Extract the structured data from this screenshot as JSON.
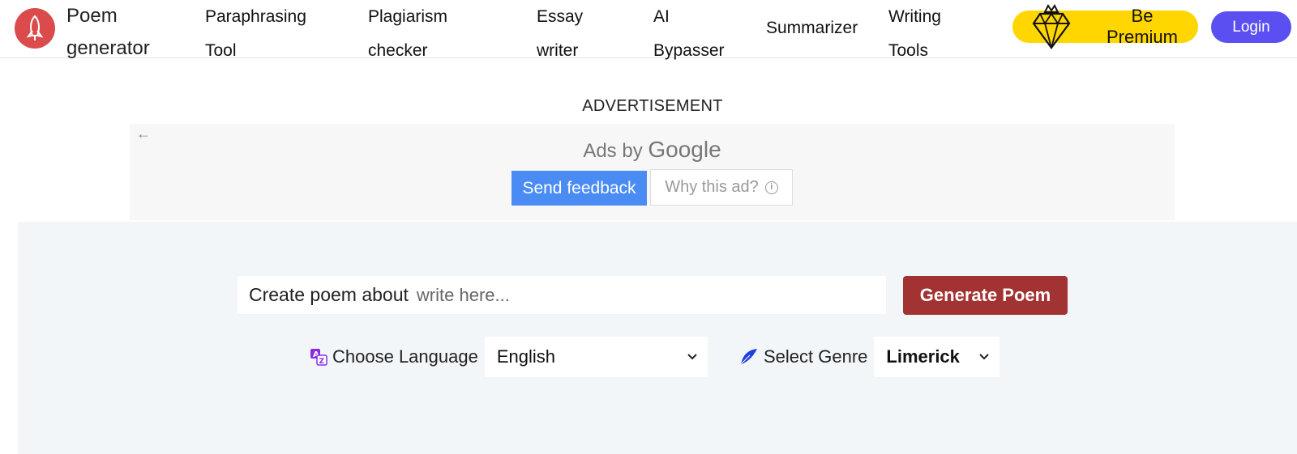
{
  "brand": {
    "name_line1": "Poem",
    "name_line2": "generator",
    "logo_icon": "rocket-icon"
  },
  "nav": [
    {
      "line1": "Paraphrasing",
      "line2": "Tool"
    },
    {
      "line1": "Plagiarism",
      "line2": "checker"
    },
    {
      "line1": "Essay",
      "line2": "writer"
    },
    {
      "line1": "AI",
      "line2": "Bypasser"
    },
    {
      "line1": "Summarizer",
      "line2": ""
    },
    {
      "line1": "Writing",
      "line2": "Tools"
    }
  ],
  "premium": {
    "line1": "Be",
    "line2": "Premium",
    "icon": "diamond-icon"
  },
  "login": {
    "label": "Login"
  },
  "ad": {
    "label": "ADVERTISEMENT",
    "ads_by": "Ads by",
    "google": "Google",
    "send_feedback": "Send feedback",
    "why_this_ad": "Why this ad?"
  },
  "generator": {
    "prompt_label": "Create poem about",
    "prompt_placeholder": "write here...",
    "generate_label": "Generate Poem",
    "language_label": "Choose Language",
    "language_value": "English",
    "genre_label": "Select Genre",
    "genre_value": "Limerick"
  },
  "colors": {
    "accent_login": "#5b4ff2",
    "premium_yellow": "#ffd600",
    "generate_red": "#a33232",
    "logo_red": "#dc4b4b",
    "ad_blue": "#4a8cf4",
    "panel_bg": "#f3f6f9"
  }
}
